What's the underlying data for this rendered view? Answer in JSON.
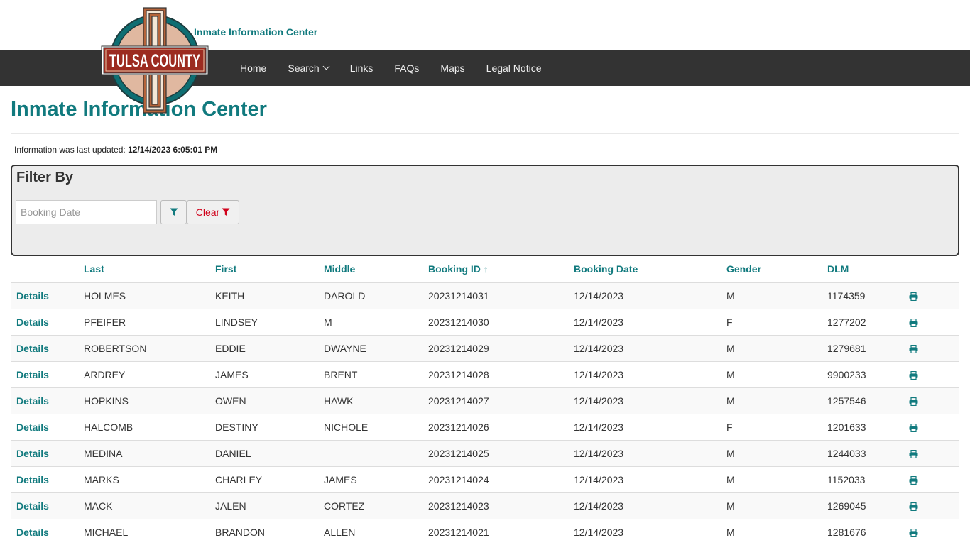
{
  "header": {
    "site_name": "Inmate Information Center",
    "logo_text": "TULSA COUNTY",
    "brand_color": "#117a7e"
  },
  "nav": {
    "items": [
      {
        "label": "Home"
      },
      {
        "label": "Search",
        "has_dropdown": true
      },
      {
        "label": "Links"
      },
      {
        "label": "FAQs"
      },
      {
        "label": "Maps"
      },
      {
        "label": "Legal Notice"
      }
    ]
  },
  "page": {
    "title": "Inmate Information Center",
    "updated_label": "Information was last updated:",
    "updated_value": "12/14/2023 6:05:01 PM"
  },
  "filter": {
    "title": "Filter By",
    "booking_date_placeholder": "Booking Date",
    "booking_date_value": "",
    "clear_label": "Clear",
    "filter_icon": "filter-icon"
  },
  "table": {
    "columns": [
      "",
      "Last",
      "First",
      "Middle",
      "Booking ID ↑",
      "Booking Date",
      "Gender",
      "DLM",
      ""
    ],
    "details_label": "Details",
    "print_icon": "print-icon",
    "rows": [
      {
        "last": "HOLMES",
        "first": "KEITH",
        "middle": "DAROLD",
        "booking_id": "20231214031",
        "booking_date": "12/14/2023",
        "gender": "M",
        "dlm": "1174359"
      },
      {
        "last": "PFEIFER",
        "first": "LINDSEY",
        "middle": "M",
        "booking_id": "20231214030",
        "booking_date": "12/14/2023",
        "gender": "F",
        "dlm": "1277202"
      },
      {
        "last": "ROBERTSON",
        "first": "EDDIE",
        "middle": "DWAYNE",
        "booking_id": "20231214029",
        "booking_date": "12/14/2023",
        "gender": "M",
        "dlm": "1279681"
      },
      {
        "last": "ARDREY",
        "first": "JAMES",
        "middle": "BRENT",
        "booking_id": "20231214028",
        "booking_date": "12/14/2023",
        "gender": "M",
        "dlm": "9900233"
      },
      {
        "last": "HOPKINS",
        "first": "OWEN",
        "middle": "HAWK",
        "booking_id": "20231214027",
        "booking_date": "12/14/2023",
        "gender": "M",
        "dlm": "1257546"
      },
      {
        "last": "HALCOMB",
        "first": "DESTINY",
        "middle": "NICHOLE",
        "booking_id": "20231214026",
        "booking_date": "12/14/2023",
        "gender": "F",
        "dlm": "1201633"
      },
      {
        "last": "MEDINA",
        "first": "DANIEL",
        "middle": "",
        "booking_id": "20231214025",
        "booking_date": "12/14/2023",
        "gender": "M",
        "dlm": "1244033"
      },
      {
        "last": "MARKS",
        "first": "CHARLEY",
        "middle": "JAMES",
        "booking_id": "20231214024",
        "booking_date": "12/14/2023",
        "gender": "M",
        "dlm": "1152033"
      },
      {
        "last": "MACK",
        "first": "JALEN",
        "middle": "CORTEZ",
        "booking_id": "20231214023",
        "booking_date": "12/14/2023",
        "gender": "M",
        "dlm": "1269045"
      },
      {
        "last": "MICHAEL",
        "first": "BRANDON",
        "middle": "ALLEN",
        "booking_id": "20231214021",
        "booking_date": "12/14/2023",
        "gender": "M",
        "dlm": "1281676"
      }
    ]
  }
}
